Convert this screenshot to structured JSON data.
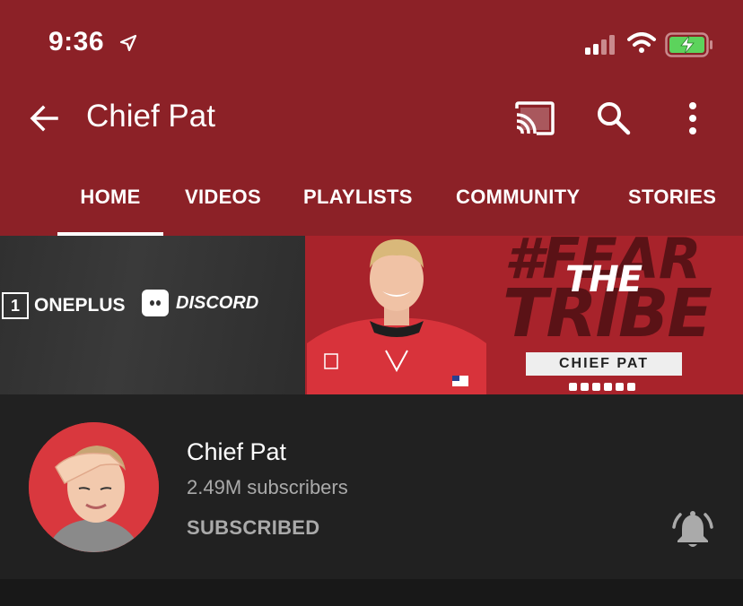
{
  "status_bar": {
    "time": "9:36"
  },
  "app_bar": {
    "title": "Chief Pat"
  },
  "tabs": [
    {
      "label": "HOME",
      "selected": true
    },
    {
      "label": "VIDEOS",
      "selected": false
    },
    {
      "label": "PLAYLISTS",
      "selected": false
    },
    {
      "label": "COMMUNITY",
      "selected": false
    },
    {
      "label": "STORIES",
      "selected": false
    }
  ],
  "banner": {
    "sponsor_1": "ONEPLUS",
    "sponsor_2": "DISCORD",
    "hashtag_line_1": "#FEAR",
    "hashtag_line_2": "TRIBE",
    "overlay": "THE",
    "nameplate": "CHIEF PAT"
  },
  "channel": {
    "name": "Chief Pat",
    "subscribers": "2.49M subscribers",
    "subscribe_state": "SUBSCRIBED"
  },
  "colors": {
    "header_bg": "#8c2127",
    "page_bg": "#212121",
    "muted_text": "#aaaaaa"
  }
}
